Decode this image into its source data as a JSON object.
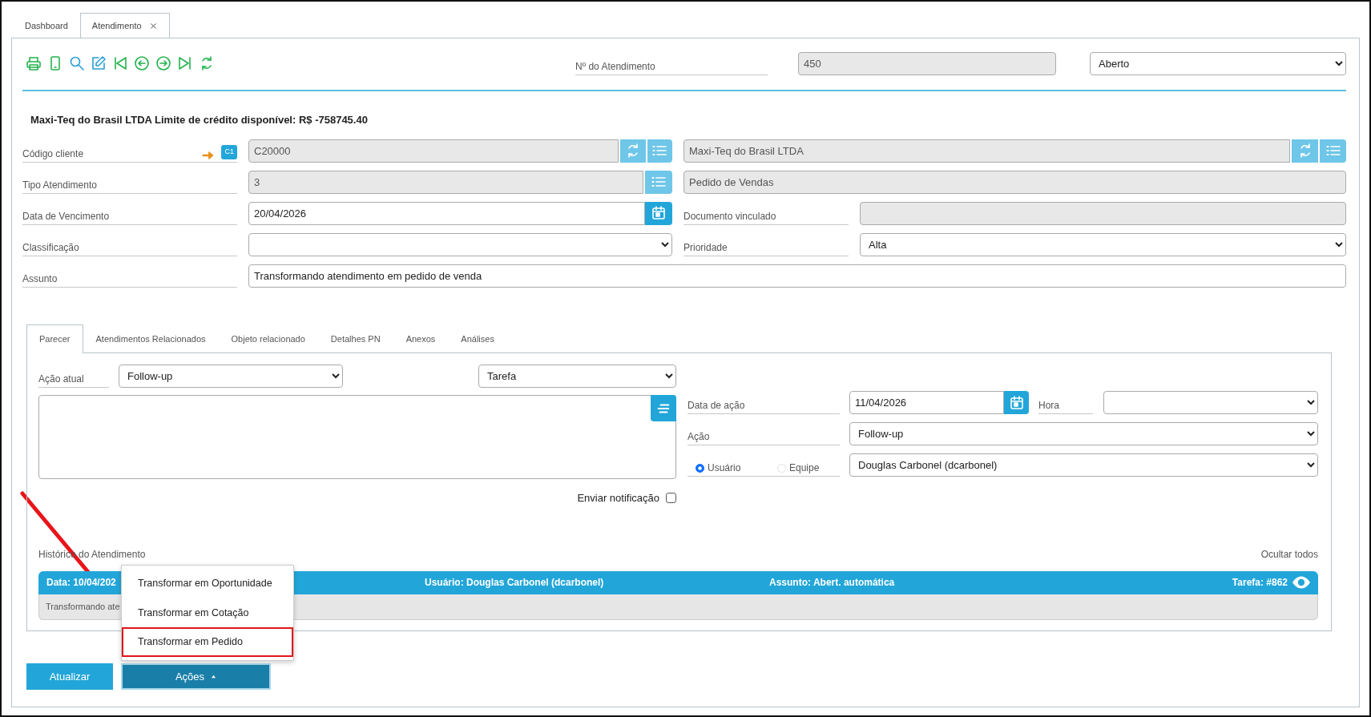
{
  "tabs": [
    {
      "label": "Dashboard",
      "selected": false,
      "closable": false
    },
    {
      "label": "Atendimento",
      "selected": true,
      "closable": true
    }
  ],
  "toolbar": {
    "number_label": "Nº do Atendimento",
    "number_value": "450",
    "status": "Aberto"
  },
  "client_title": "Maxi-Teq do Brasil LTDA Limite de crédito disponível: R$ -758745.40",
  "form": {
    "client_code": {
      "label": "Código cliente",
      "badge": "C1",
      "value": "C20000",
      "name": "Maxi-Teq do Brasil LTDA"
    },
    "service_type": {
      "label": "Tipo Atendimento",
      "value": "3",
      "description": "Pedido de Vendas"
    },
    "due_date": {
      "label": "Data de Vencimento",
      "value": "20/04/2026"
    },
    "linked_document": {
      "label": "Documento vinculado"
    },
    "classification": {
      "label": "Classificação"
    },
    "priority": {
      "label": "Prioridade",
      "value": "Alta"
    },
    "subject": {
      "label": "Assunto",
      "value": "Transformando atendimento em pedido de venda"
    }
  },
  "detail_tabs": [
    {
      "label": "Parecer",
      "selected": true
    },
    {
      "label": "Atendimentos Relacionados",
      "selected": false
    },
    {
      "label": "Objeto relacionado",
      "selected": false
    },
    {
      "label": "Detalhes PN",
      "selected": false
    },
    {
      "label": "Anexos",
      "selected": false
    },
    {
      "label": "Análises",
      "selected": false
    }
  ],
  "parecer": {
    "current_action_label": "Ação atual",
    "current_action": "Follow-up",
    "type": "Tarefa",
    "action_date_label": "Data de ação",
    "action_date": "11/04/2026",
    "time_label": "Hora",
    "action_label": "Ação",
    "action": "Follow-up",
    "assignee_types": [
      {
        "label": "Usuário",
        "selected": true
      },
      {
        "label": "Equipe",
        "selected": false
      }
    ],
    "assignee": "Douglas Carbonel (dcarbonel)",
    "notify_label": "Enviar notificação",
    "notify": false
  },
  "history": {
    "label": "Histórico do Atendimento",
    "hide_all": "Ocultar todos",
    "entries": [
      {
        "date": "Data: 10/04/202",
        "user": "Usuário: Douglas Carbonel (dcarbonel)",
        "subject": "Assunto: Abert. automática",
        "task": "Tarefa: #862",
        "text": "Transformando ate"
      }
    ]
  },
  "actions_menu": {
    "items": [
      {
        "label": "Transformar em Oportunidade",
        "highlighted": false
      },
      {
        "label": "Transformar em Cotação",
        "highlighted": false
      },
      {
        "label": "Transformar em Pedido",
        "highlighted": true
      }
    ]
  },
  "buttons": {
    "update": "Atualizar",
    "actions": "Ações"
  }
}
